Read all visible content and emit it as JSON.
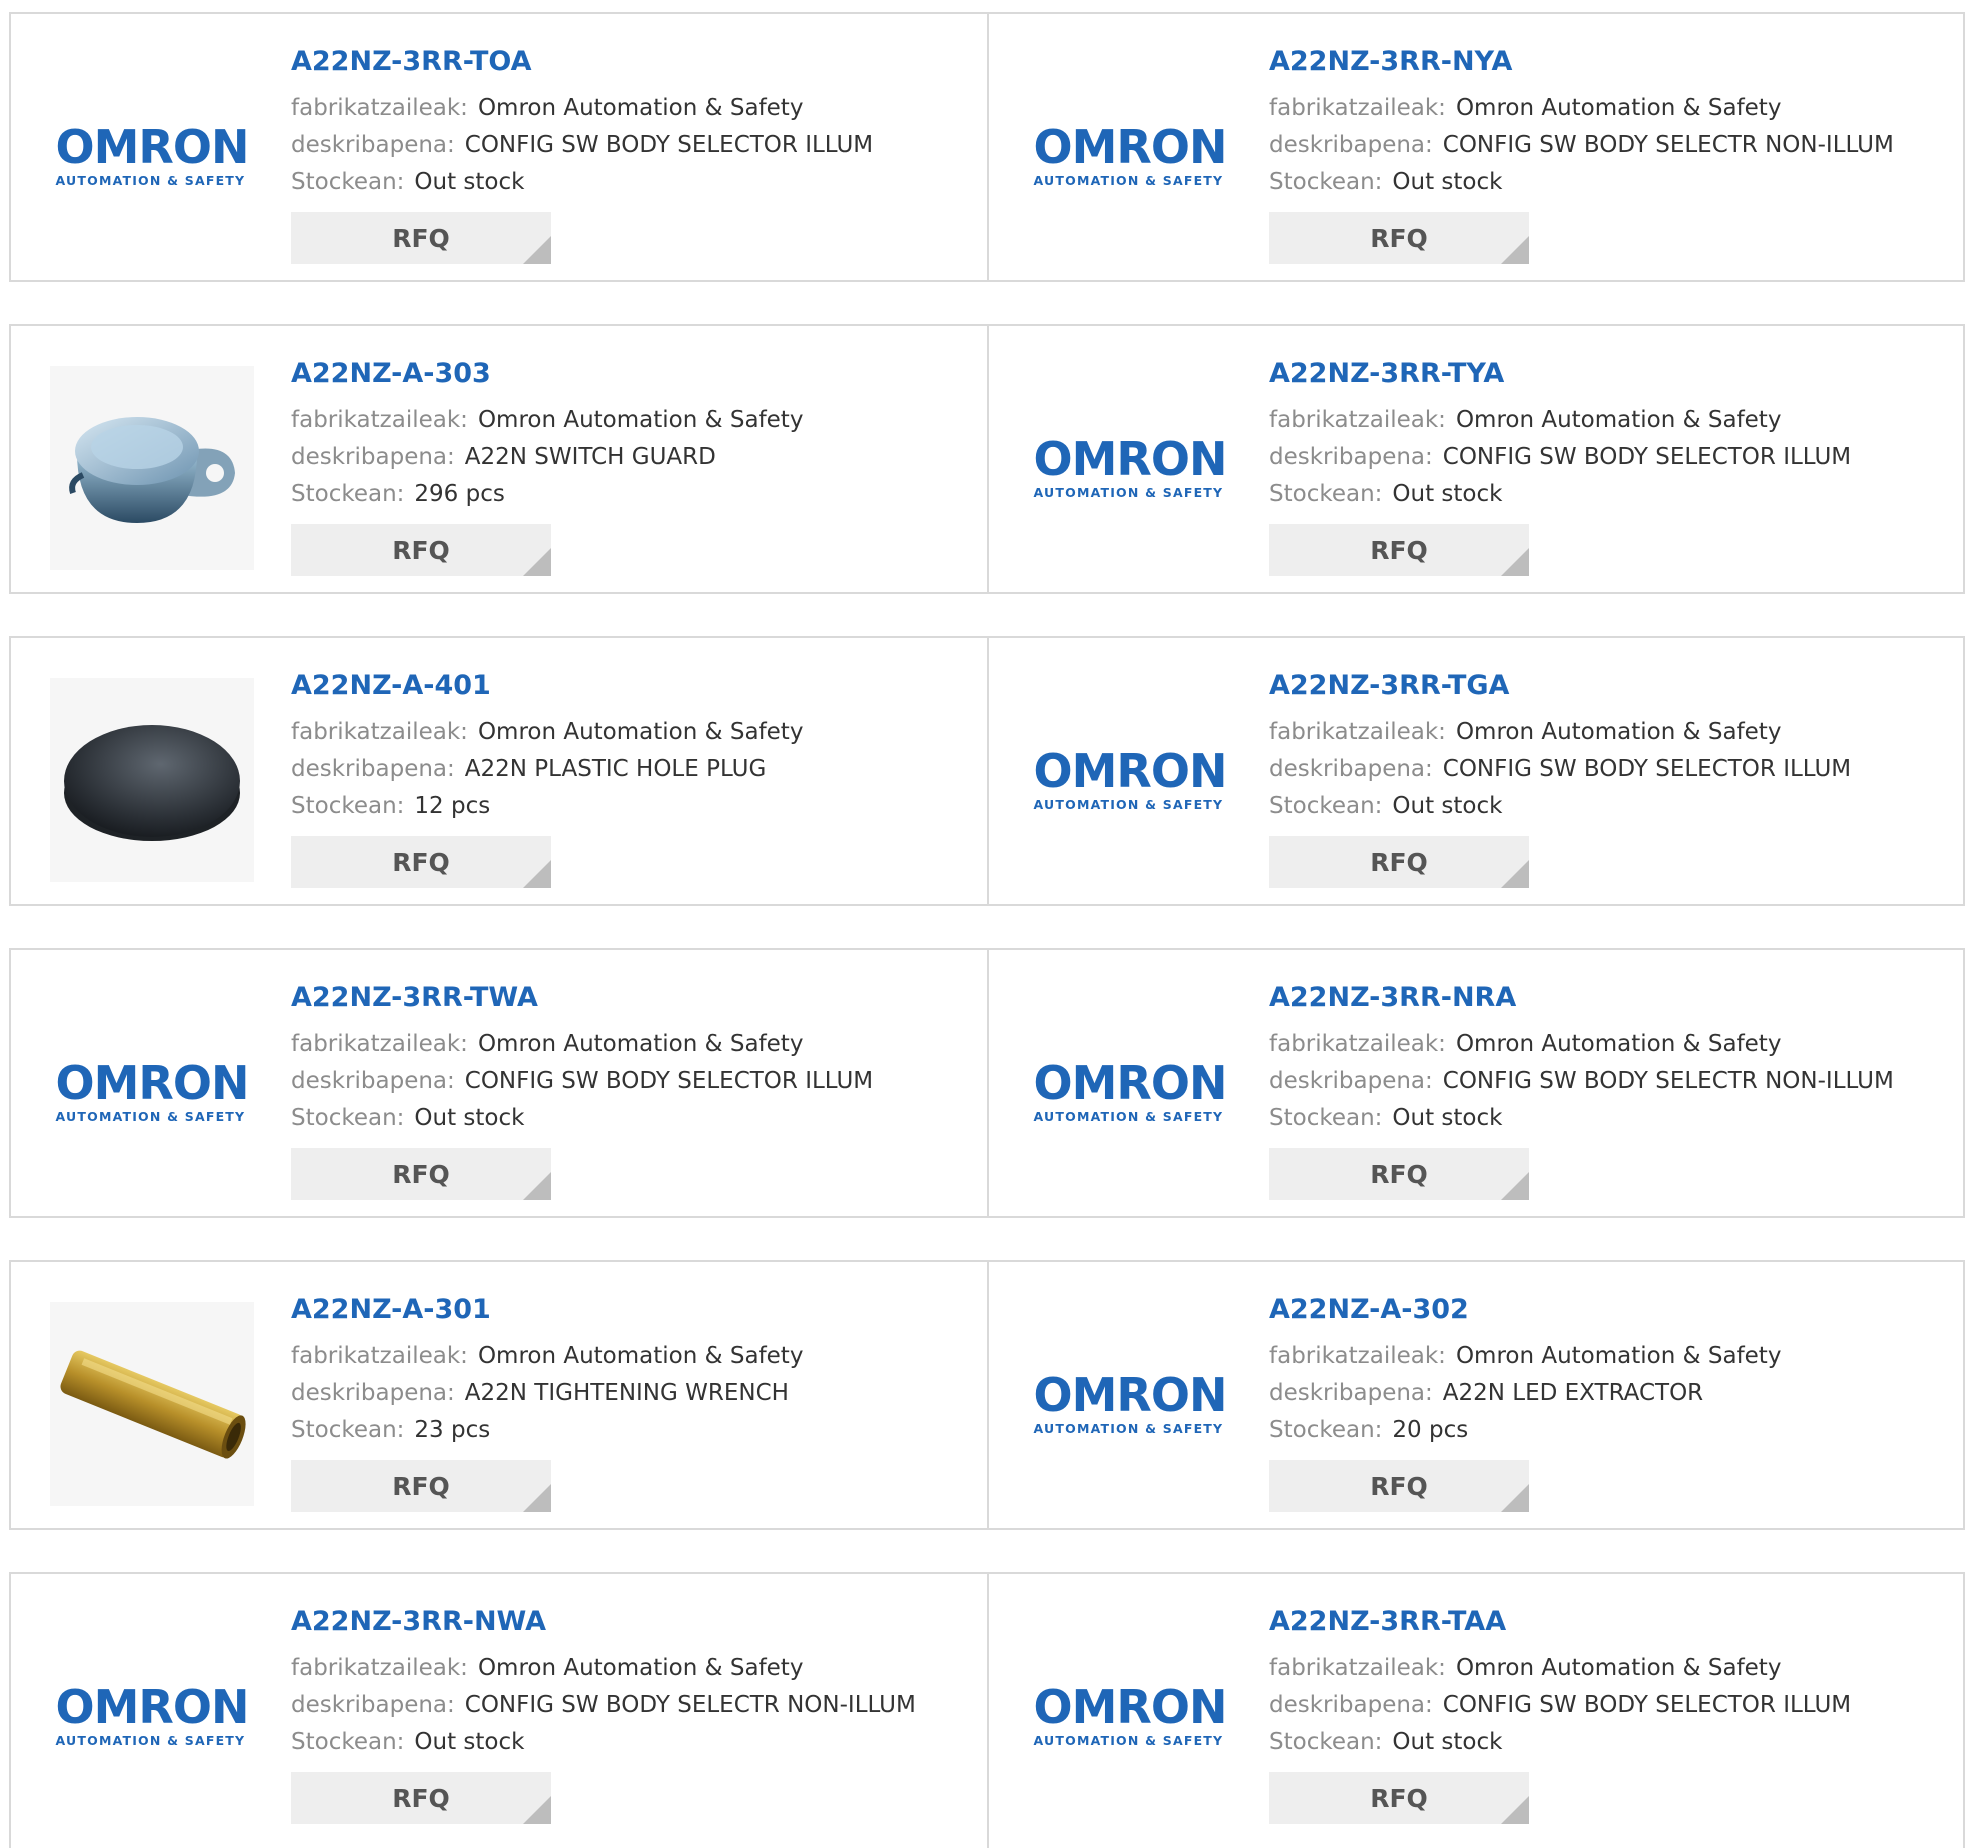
{
  "labels": {
    "manufacturer": "fabrikatzaileak:",
    "description": "deskribapena:",
    "stock": "Stockean:",
    "rfq": "RFQ"
  },
  "logo": {
    "word": "OMRON",
    "sub": "AUTOMATION & SAFETY",
    "color": "#1f66b7"
  },
  "products": [
    {
      "part": "A22NZ-3RR-TOA",
      "manufacturer": "Omron Automation & Safety",
      "description": "CONFIG SW BODY SELECTOR ILLUM",
      "stock": "Out stock",
      "image": "omron-logo"
    },
    {
      "part": "A22NZ-3RR-NYA",
      "manufacturer": "Omron Automation & Safety",
      "description": "CONFIG SW BODY SELECTR NON-ILLUM",
      "stock": "Out stock",
      "image": "omron-logo"
    },
    {
      "part": "A22NZ-A-303",
      "manufacturer": "Omron Automation & Safety",
      "description": "A22N SWITCH GUARD",
      "stock": "296 pcs",
      "image": "switch-guard-photo"
    },
    {
      "part": "A22NZ-3RR-TYA",
      "manufacturer": "Omron Automation & Safety",
      "description": "CONFIG SW BODY SELECTOR ILLUM",
      "stock": "Out stock",
      "image": "omron-logo"
    },
    {
      "part": "A22NZ-A-401",
      "manufacturer": "Omron Automation & Safety",
      "description": "A22N PLASTIC HOLE PLUG",
      "stock": "12 pcs",
      "image": "hole-plug-photo"
    },
    {
      "part": "A22NZ-3RR-TGA",
      "manufacturer": "Omron Automation & Safety",
      "description": "CONFIG SW BODY SELECTOR ILLUM",
      "stock": "Out stock",
      "image": "omron-logo"
    },
    {
      "part": "A22NZ-3RR-TWA",
      "manufacturer": "Omron Automation & Safety",
      "description": "CONFIG SW BODY SELECTOR ILLUM",
      "stock": "Out stock",
      "image": "omron-logo"
    },
    {
      "part": "A22NZ-3RR-NRA",
      "manufacturer": "Omron Automation & Safety",
      "description": "CONFIG SW BODY SELECTR NON-ILLUM",
      "stock": "Out stock",
      "image": "omron-logo"
    },
    {
      "part": "A22NZ-A-301",
      "manufacturer": "Omron Automation & Safety",
      "description": "A22N TIGHTENING WRENCH",
      "stock": "23 pcs",
      "image": "wrench-photo"
    },
    {
      "part": "A22NZ-A-302",
      "manufacturer": "Omron Automation & Safety",
      "description": "A22N LED EXTRACTOR",
      "stock": "20 pcs",
      "image": "omron-logo"
    },
    {
      "part": "A22NZ-3RR-NWA",
      "manufacturer": "Omron Automation & Safety",
      "description": "CONFIG SW BODY SELECTR NON-ILLUM",
      "stock": "Out stock",
      "image": "omron-logo"
    },
    {
      "part": "A22NZ-3RR-TAA",
      "manufacturer": "Omron Automation & Safety",
      "description": "CONFIG SW BODY SELECTOR ILLUM",
      "stock": "Out stock",
      "image": "omron-logo"
    }
  ]
}
